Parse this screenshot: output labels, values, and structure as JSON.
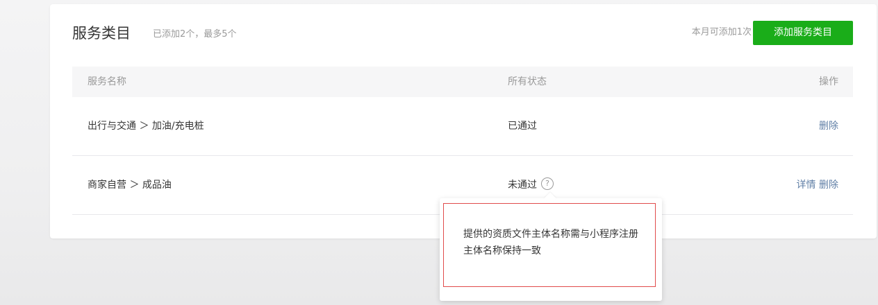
{
  "header": {
    "title": "服务类目",
    "subtitle": "已添加2个，最多5个",
    "quota": "本月可添加1次",
    "add_button": "添加服务类目"
  },
  "table": {
    "columns": [
      "服务名称",
      "所有状态",
      "操作"
    ],
    "rows": [
      {
        "name": "出行与交通 ＞ 加油/充电桩",
        "status": "已通过",
        "actions": [
          "删除"
        ]
      },
      {
        "name": "商家自营 ＞ 成品油",
        "status": "未通过",
        "actions": [
          "详情",
          "删除"
        ]
      }
    ]
  },
  "tooltip": {
    "text": "提供的资质文件主体名称需与小程序注册主体名称保持一致"
  },
  "icons": {
    "help": "question-circle-icon"
  },
  "colors": {
    "primary": "#1aad19",
    "link": "#607fa6",
    "highlight_border": "#e14b4b"
  }
}
